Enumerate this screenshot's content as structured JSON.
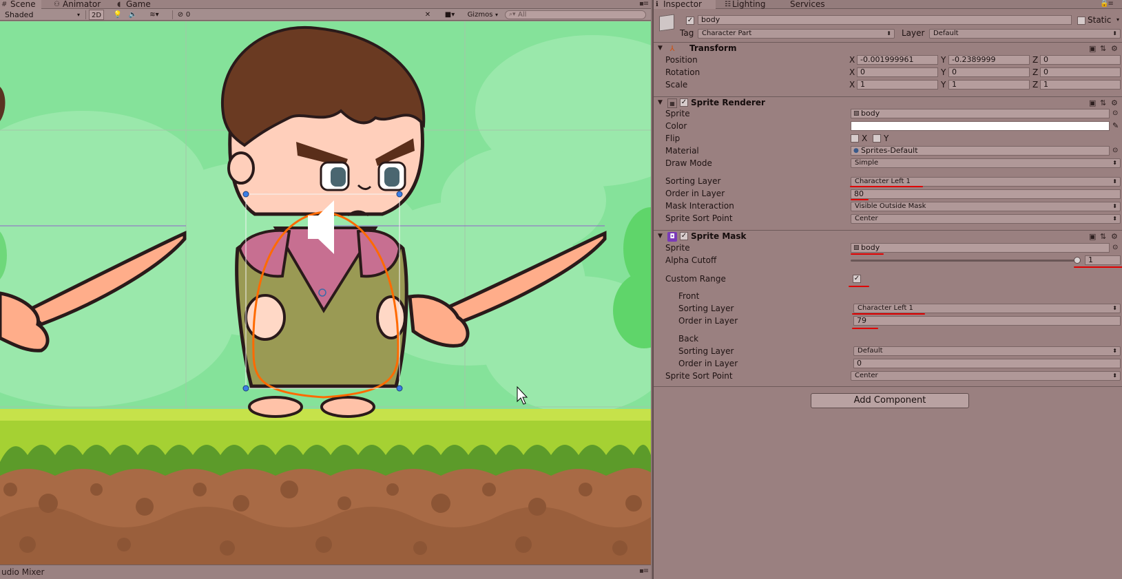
{
  "scene_tabs": [
    {
      "label": "Scene",
      "icon": "scene-icon"
    },
    {
      "label": "Animator",
      "icon": "animator-icon"
    },
    {
      "label": "Game",
      "icon": "game-icon"
    }
  ],
  "scene_toolbar": {
    "shading": "Shaded",
    "mode_2d": "2D",
    "hidden_count": "0",
    "gizmos": "Gizmos",
    "search_placeholder": "All"
  },
  "audio_mixer": "udio Mixer",
  "inspector_tabs": [
    {
      "label": "Inspector",
      "icon": "info-icon"
    },
    {
      "label": "Lighting",
      "icon": "lighting-icon"
    },
    {
      "label": "Services",
      "icon": ""
    }
  ],
  "object": {
    "name": "body",
    "static_label": "Static",
    "tag_label": "Tag",
    "tag_value": "Character Part",
    "layer_label": "Layer",
    "layer_value": "Default"
  },
  "transform": {
    "title": "Transform",
    "rows": [
      {
        "label": "Position",
        "x": "-0.001999961",
        "y": "-0.2389999",
        "z": "0"
      },
      {
        "label": "Rotation",
        "x": "0",
        "y": "0",
        "z": "0"
      },
      {
        "label": "Scale",
        "x": "1",
        "y": "1",
        "z": "1"
      }
    ],
    "axis_x": "X",
    "axis_y": "Y",
    "axis_z": "Z"
  },
  "sprite_renderer": {
    "title": "Sprite Renderer",
    "sprite_label": "Sprite",
    "sprite_value": "body",
    "color_label": "Color",
    "color_value": "#ffffff",
    "flip_label": "Flip",
    "flip_x": "X",
    "flip_y": "Y",
    "material_label": "Material",
    "material_value": "Sprites-Default",
    "draw_mode_label": "Draw Mode",
    "draw_mode_value": "Simple",
    "sorting_layer_label": "Sorting Layer",
    "sorting_layer_value": "Character Left 1",
    "order_label": "Order in Layer",
    "order_value": "80",
    "mask_label": "Mask Interaction",
    "mask_value": "Visible Outside Mask",
    "sort_point_label": "Sprite Sort Point",
    "sort_point_value": "Center"
  },
  "sprite_mask": {
    "title": "Sprite Mask",
    "sprite_label": "Sprite",
    "sprite_value": "body",
    "alpha_label": "Alpha Cutoff",
    "alpha_value": "1",
    "alpha_fraction": 1.0,
    "custom_range_label": "Custom Range",
    "front_label": "Front",
    "front_sorting_label": "Sorting Layer",
    "front_sorting_value": "Character Left 1",
    "front_order_label": "Order in Layer",
    "front_order_value": "79",
    "back_label": "Back",
    "back_sorting_label": "Sorting Layer",
    "back_sorting_value": "Default",
    "back_order_label": "Order in Layer",
    "back_order_value": "0",
    "sort_point_label": "Sprite Sort Point",
    "sort_point_value": "Center"
  },
  "add_component": "Add Component",
  "colors": {
    "inspector_bg": "#9a8080",
    "sky": "#85e29a",
    "grass": "#9ccf2f",
    "dirt": "#a86a45",
    "annotation_red": "#e00000",
    "mask_outline": "#ff6a00"
  }
}
